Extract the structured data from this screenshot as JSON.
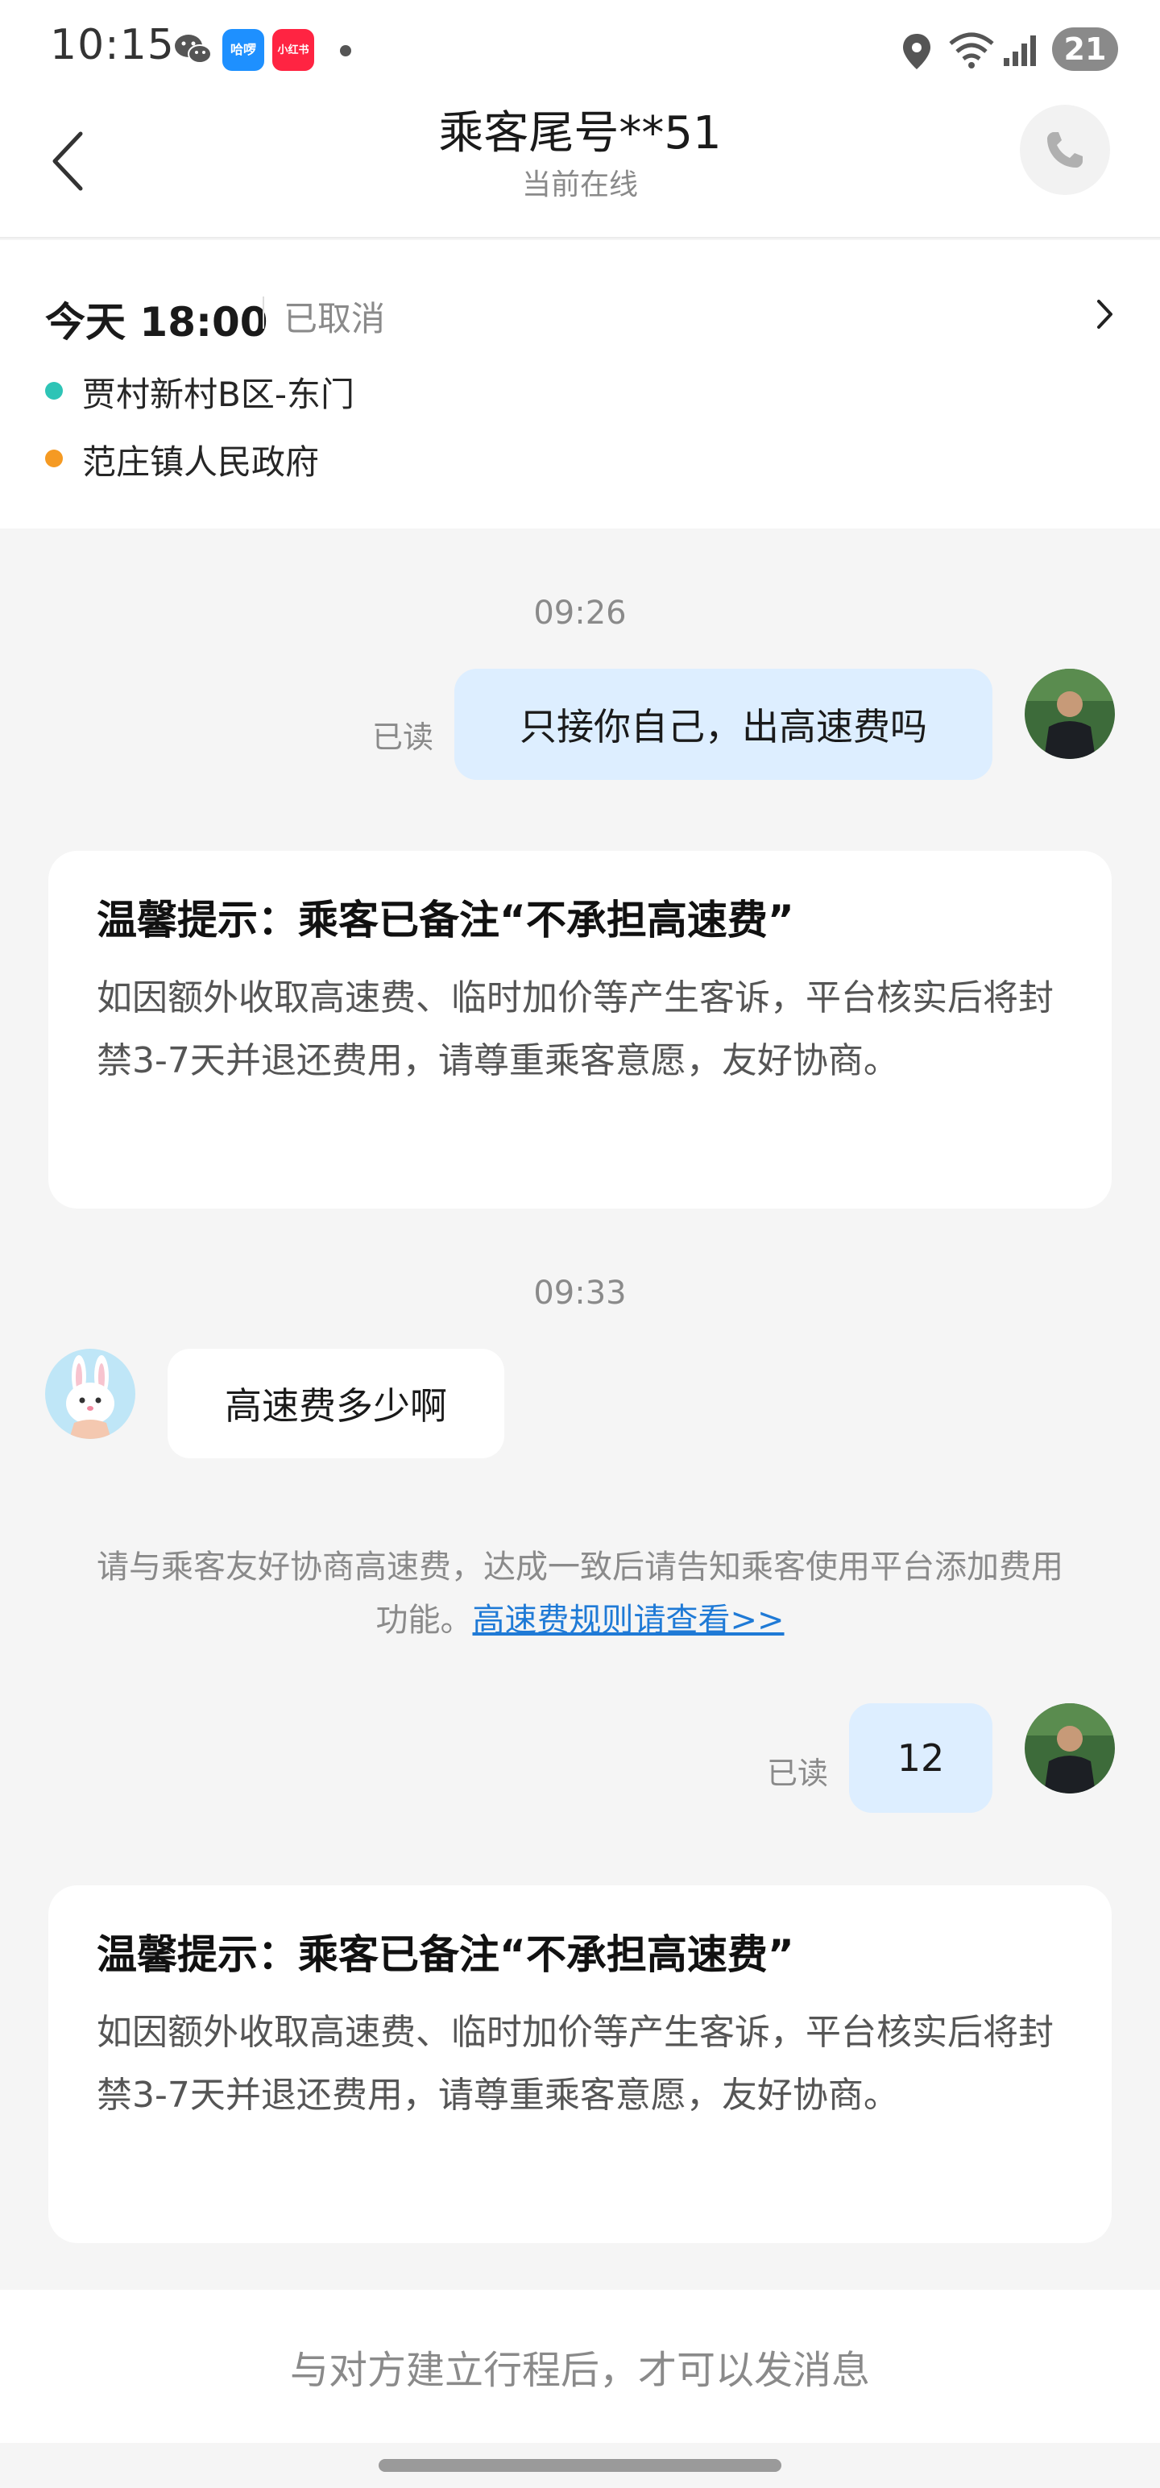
{
  "status_bar": {
    "time": "10:15",
    "battery": "21",
    "apps": [
      {
        "name": "wechat-icon"
      },
      {
        "name": "hellobike-icon",
        "label": "哈啰"
      },
      {
        "name": "xiaohongshu-icon",
        "label": "小红书"
      }
    ]
  },
  "header": {
    "title": "乘客尾号**51",
    "subtitle": "当前在线"
  },
  "trip": {
    "time": "今天 18:00",
    "status": "已取消",
    "origin": "贾村新村B区-东门",
    "destination": "范庄镇人民政府",
    "origin_color": "#2ec4b6",
    "destination_color": "#f59a23"
  },
  "chat": {
    "time_1": "09:26",
    "msg_1": {
      "text": "只接你自己，出高速费吗",
      "read": "已读"
    },
    "notice_1": {
      "title": "温馨提示：乘客已备注“不承担高速费”",
      "body": "如因额外收取高速费、临时加价等产生客诉，平台核实后将封禁3-7天并退还费用，请尊重乘客意愿，友好协商。"
    },
    "time_2": "09:33",
    "msg_2": {
      "text": "高速费多少啊"
    },
    "system_tip": {
      "text": "请与乘客友好协商高速费，达成一致后请告知乘客使用平台添加费用功能。",
      "link": "高速费规则请查看>>"
    },
    "msg_3": {
      "text": "12",
      "read": "已读"
    },
    "notice_2": {
      "title": "温馨提示：乘客已备注“不承担高速费”",
      "body": "如因额外收取高速费、临时加价等产生客诉，平台核实后将封禁3-7天并退还费用，请尊重乘客意愿，友好协商。"
    }
  },
  "footer": {
    "text": "与对方建立行程后，才可以发消息"
  },
  "colors": {
    "accent_link": "#1f7ad6",
    "my_bubble": "#ddeeff",
    "background": "#f5f5f5"
  }
}
